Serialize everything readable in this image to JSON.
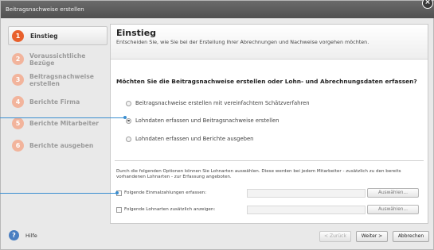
{
  "window": {
    "title": "Beitragsnachweise erstellen"
  },
  "steps": [
    {
      "num": "1",
      "label": "Einstieg"
    },
    {
      "num": "2",
      "label": "Voraussichtliche Bezüge"
    },
    {
      "num": "3",
      "label": "Beitragsnachweise erstellen"
    },
    {
      "num": "4",
      "label": "Berichte Firma"
    },
    {
      "num": "5",
      "label": "Berichte Mitarbeiter"
    },
    {
      "num": "6",
      "label": "Berichte ausgeben"
    }
  ],
  "header": {
    "title": "Einstieg",
    "subtitle": "Entscheiden Sie, wie Sie bei der Erstellung Ihrer Abrechnungen und Nachweise vorgehen möchten."
  },
  "question": "Möchten Sie die Beitragsnachweise erstellen oder Lohn- und Abrechnungsdaten erfassen?",
  "radios": [
    {
      "label": "Beitragsnachweise erstellen mit vereinfachtem Schätzverfahren",
      "checked": false
    },
    {
      "label": "Lohndaten erfassen und Beitragsnachweise erstellen",
      "checked": true
    },
    {
      "label": "Lohndaten erfassen und Berichte ausgeben",
      "checked": false
    }
  ],
  "info_text": "Durch die folgenden Optionen können Sie Lohnarten auswählen. Diese werden bei jedem Mitarbeiter - zusätzlich zu den bereits vorhandenen Lohnarten - zur Erfassung angeboten.",
  "options": [
    {
      "label": "Folgende Einmalzahlungen erfassen:",
      "button": "Auswählen..."
    },
    {
      "label": "Folgende Lohnarten zusätzlich anzeigen:",
      "button": "Auswählen..."
    }
  ],
  "footer": {
    "help": "Hilfe",
    "back": "< Zurück",
    "next": "Weiter >",
    "cancel": "Abbrechen"
  },
  "colors": {
    "accent": "#e8602c",
    "callout": "#3a8ed0",
    "help": "#4a7fc1"
  }
}
